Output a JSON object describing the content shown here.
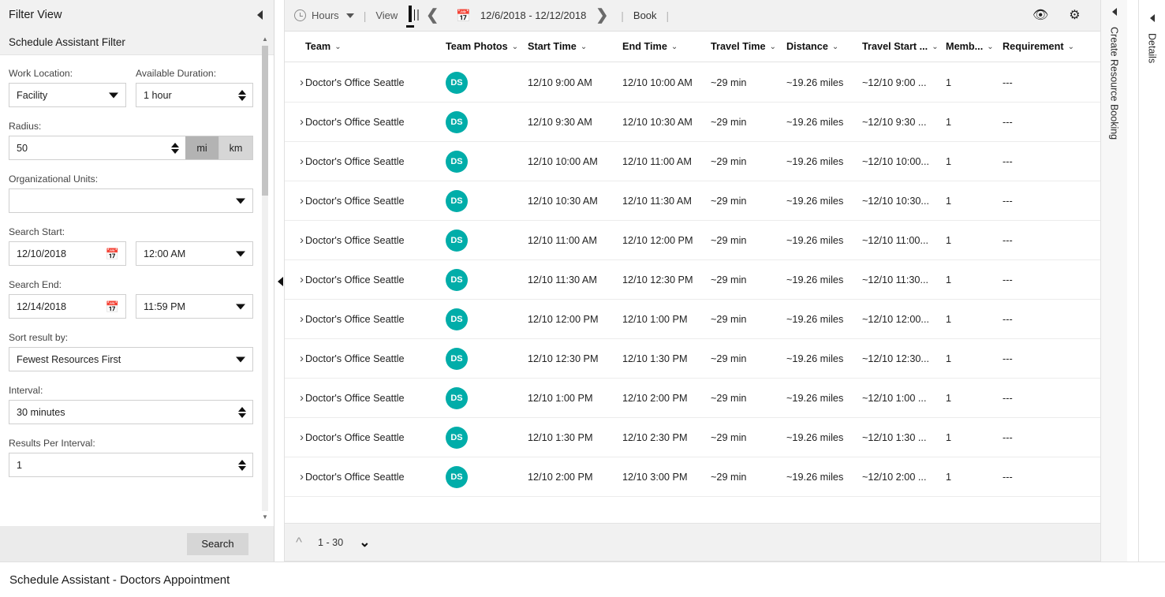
{
  "filter": {
    "title": "Filter View",
    "subtitle": "Schedule Assistant Filter",
    "collapse_icon": "collapse-left-arrow",
    "fields": {
      "work_location_label": "Work Location:",
      "work_location_value": "Facility",
      "available_duration_label": "Available Duration:",
      "available_duration_value": "1 hour",
      "radius_label": "Radius:",
      "radius_value": "50",
      "unit_mi": "mi",
      "unit_km": "km",
      "unit_selected": "mi",
      "org_units_label": "Organizational Units:",
      "org_units_value": "",
      "search_start_label": "Search Start:",
      "search_start_date": "12/10/2018",
      "search_start_time": "12:00 AM",
      "search_end_label": "Search End:",
      "search_end_date": "12/14/2018",
      "search_end_time": "11:59 PM",
      "sort_label": "Sort result by:",
      "sort_value": "Fewest Resources First",
      "interval_label": "Interval:",
      "interval_value": "30 minutes",
      "results_per_interval_label": "Results Per Interval:",
      "results_per_interval_value": "1"
    },
    "search_button": "Search"
  },
  "toolbar": {
    "hours_label": "Hours",
    "clock_icon": "clock-icon",
    "hours_caret": "chevron-down-icon",
    "view_label": "View",
    "grid_icon": "grid-view-icon",
    "prev_icon": "chevron-left-icon",
    "calendar_icon": "calendar-icon",
    "date_range": "12/6/2018 - 12/12/2018",
    "next_icon": "chevron-right-icon",
    "book_label": "Book",
    "eye_icon": "eye-icon",
    "gear_icon": "gear-icon",
    "refresh_icon": "refresh-icon"
  },
  "grid": {
    "columns": [
      {
        "label": "Team",
        "key": "team"
      },
      {
        "label": "Team Photos",
        "key": "photo"
      },
      {
        "label": "Start Time",
        "key": "start"
      },
      {
        "label": "End Time",
        "key": "end"
      },
      {
        "label": "Travel Time",
        "key": "travel"
      },
      {
        "label": "Distance",
        "key": "distance"
      },
      {
        "label": "Travel Start ...",
        "key": "travel_start"
      },
      {
        "label": "Memb...",
        "key": "members"
      },
      {
        "label": "Requirement",
        "key": "requirement"
      }
    ],
    "avatar_color": "#00ADA9",
    "avatar_initials": "DS",
    "rows": [
      {
        "team": "Doctor's Office Seattle",
        "start": "12/10 9:00 AM",
        "end": "12/10 10:00 AM",
        "travel": "~29 min",
        "distance": "~19.26 miles",
        "travel_start": "~12/10 9:00 ...",
        "members": "1",
        "requirement": "---"
      },
      {
        "team": "Doctor's Office Seattle",
        "start": "12/10 9:30 AM",
        "end": "12/10 10:30 AM",
        "travel": "~29 min",
        "distance": "~19.26 miles",
        "travel_start": "~12/10 9:30 ...",
        "members": "1",
        "requirement": "---"
      },
      {
        "team": "Doctor's Office Seattle",
        "start": "12/10 10:00 AM",
        "end": "12/10 11:00 AM",
        "travel": "~29 min",
        "distance": "~19.26 miles",
        "travel_start": "~12/10 10:00...",
        "members": "1",
        "requirement": "---"
      },
      {
        "team": "Doctor's Office Seattle",
        "start": "12/10 10:30 AM",
        "end": "12/10 11:30 AM",
        "travel": "~29 min",
        "distance": "~19.26 miles",
        "travel_start": "~12/10 10:30...",
        "members": "1",
        "requirement": "---"
      },
      {
        "team": "Doctor's Office Seattle",
        "start": "12/10 11:00 AM",
        "end": "12/10 12:00 PM",
        "travel": "~29 min",
        "distance": "~19.26 miles",
        "travel_start": "~12/10 11:00...",
        "members": "1",
        "requirement": "---"
      },
      {
        "team": "Doctor's Office Seattle",
        "start": "12/10 11:30 AM",
        "end": "12/10 12:30 PM",
        "travel": "~29 min",
        "distance": "~19.26 miles",
        "travel_start": "~12/10 11:30...",
        "members": "1",
        "requirement": "---"
      },
      {
        "team": "Doctor's Office Seattle",
        "start": "12/10 12:00 PM",
        "end": "12/10 1:00 PM",
        "travel": "~29 min",
        "distance": "~19.26 miles",
        "travel_start": "~12/10 12:00...",
        "members": "1",
        "requirement": "---"
      },
      {
        "team": "Doctor's Office Seattle",
        "start": "12/10 12:30 PM",
        "end": "12/10 1:30 PM",
        "travel": "~29 min",
        "distance": "~19.26 miles",
        "travel_start": "~12/10 12:30...",
        "members": "1",
        "requirement": "---"
      },
      {
        "team": "Doctor's Office Seattle",
        "start": "12/10 1:00 PM",
        "end": "12/10 2:00 PM",
        "travel": "~29 min",
        "distance": "~19.26 miles",
        "travel_start": "~12/10 1:00 ...",
        "members": "1",
        "requirement": "---"
      },
      {
        "team": "Doctor's Office Seattle",
        "start": "12/10 1:30 PM",
        "end": "12/10 2:30 PM",
        "travel": "~29 min",
        "distance": "~19.26 miles",
        "travel_start": "~12/10 1:30 ...",
        "members": "1",
        "requirement": "---"
      },
      {
        "team": "Doctor's Office Seattle",
        "start": "12/10 2:00 PM",
        "end": "12/10 3:00 PM",
        "travel": "~29 min",
        "distance": "~19.26 miles",
        "travel_start": "~12/10 2:00 ...",
        "members": "1",
        "requirement": "---"
      }
    ],
    "pagination": {
      "range": "1 - 30",
      "prev_icon": "chevron-up-icon",
      "next_icon": "chevron-down-icon"
    }
  },
  "rails": {
    "create_booking": "Create Resource Booking",
    "details": "Details"
  },
  "status": {
    "text": "Schedule Assistant - Doctors Appointment"
  }
}
